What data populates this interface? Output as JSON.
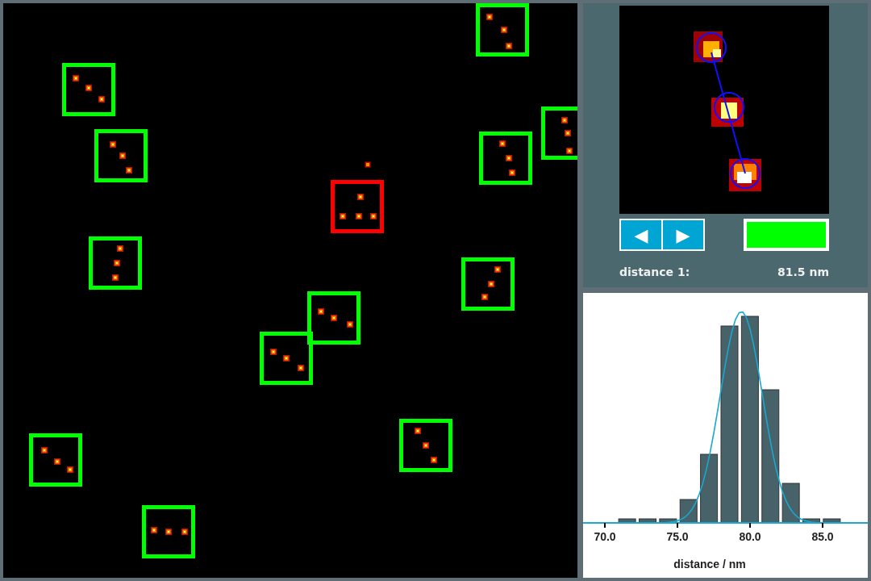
{
  "image_view": {
    "particles": [
      {
        "color": "#00ff00"
      },
      {
        "color": "#00ff00"
      },
      {
        "color": "#00ff00"
      },
      {
        "color": "#00ff00"
      },
      {
        "color": "#00ff00"
      },
      {
        "color": "#ff0000"
      },
      {
        "color": "#00ff00"
      },
      {
        "color": "#00ff00"
      },
      {
        "color": "#00ff00"
      },
      {
        "color": "#00ff00"
      },
      {
        "color": "#00ff00"
      },
      {
        "color": "#00ff00"
      },
      {
        "color": "#00ff00"
      }
    ]
  },
  "detail": {
    "prev_button": "◀",
    "next_button": "▶",
    "accepted": true,
    "distance_label": "distance 1:",
    "distance_value": "81.5 nm"
  },
  "histogram": {
    "tick_labels": [
      "70.0",
      "75.0",
      "80.0",
      "85.0"
    ],
    "xlabel": "distance / nm"
  }
}
